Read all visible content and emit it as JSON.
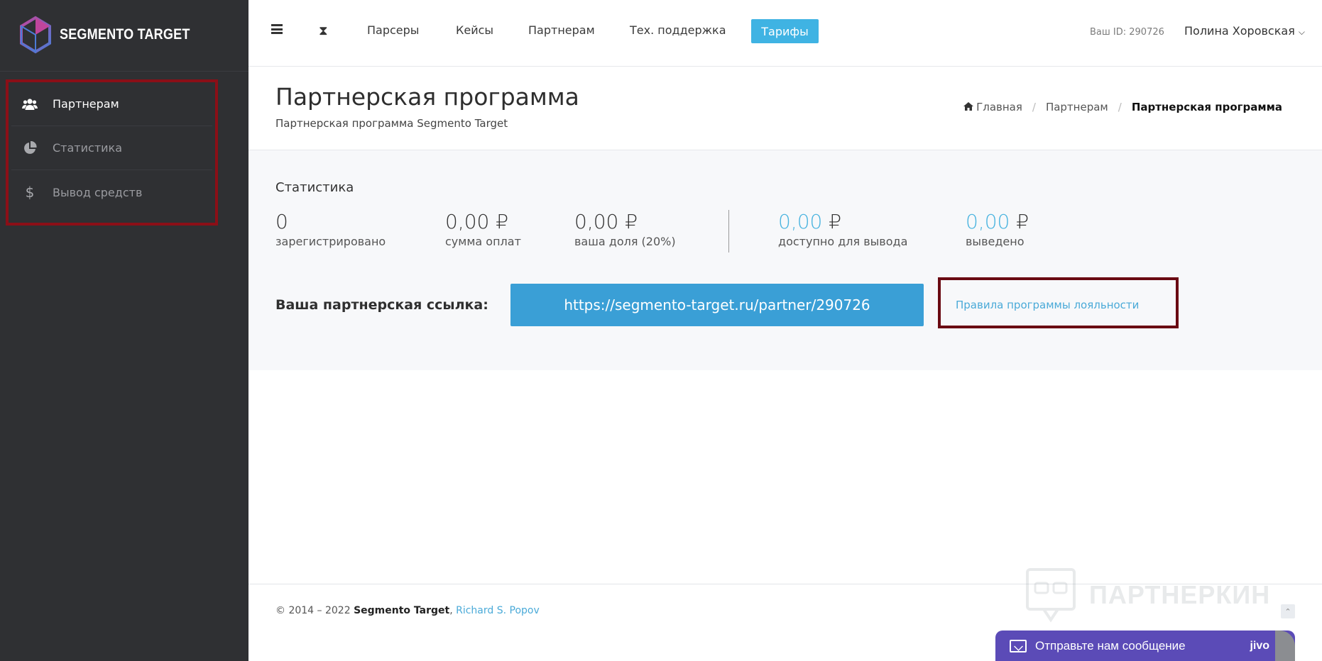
{
  "brand": {
    "name": "SEGMENTO TARGET"
  },
  "sidebar": {
    "items": [
      {
        "label": "Партнерам",
        "icon": "users-icon",
        "active": true
      },
      {
        "label": "Статистика",
        "icon": "pie-chart-icon",
        "active": false
      },
      {
        "label": "Вывод средств",
        "icon": "dollar-icon",
        "active": false
      }
    ]
  },
  "topnav": {
    "links": [
      "Парсеры",
      "Кейсы",
      "Партнерам",
      "Тех. поддержка"
    ],
    "tarify": "Тарифы",
    "user_id": "Ваш ID: 290726",
    "user_name": "Полина Хоровская"
  },
  "header": {
    "title": "Партнерская программа",
    "subtitle": "Партнерская программа Segmento Target",
    "breadcrumb": [
      "Главная",
      "Партнерам",
      "Партнерская программа"
    ]
  },
  "stats": {
    "title": "Статистика",
    "items": [
      {
        "value": "0",
        "caption": "зарегистрировано"
      },
      {
        "value": "0,00",
        "currency": "₽",
        "caption": "сумма оплат"
      },
      {
        "value": "0,00",
        "currency": "₽",
        "caption": "ваша доля (20%)"
      },
      {
        "value": "0,00",
        "currency": "₽",
        "caption": "доступно для вывода"
      },
      {
        "value": "0,00",
        "currency": "₽",
        "caption": "выведено"
      }
    ]
  },
  "referral": {
    "label": "Ваша партнерская ссылка:",
    "link": "https://segmento-target.ru/partner/290726",
    "rules": "Правила программы лояльности"
  },
  "footer": {
    "copyright": "© 2014 – 2022 ",
    "company": "Segmento Target",
    "separator": ",",
    "author": "Richard S. Popov"
  },
  "watermark": "ПАРТНЕРКИН",
  "chat": {
    "message": "Отправьте нам сообщение",
    "brand": "jivo"
  },
  "colors": {
    "accent": "#3fb3e3",
    "link_button": "#3a9fd6",
    "sidebar": "#2f3033",
    "highlight_box": "#8b0f17"
  }
}
